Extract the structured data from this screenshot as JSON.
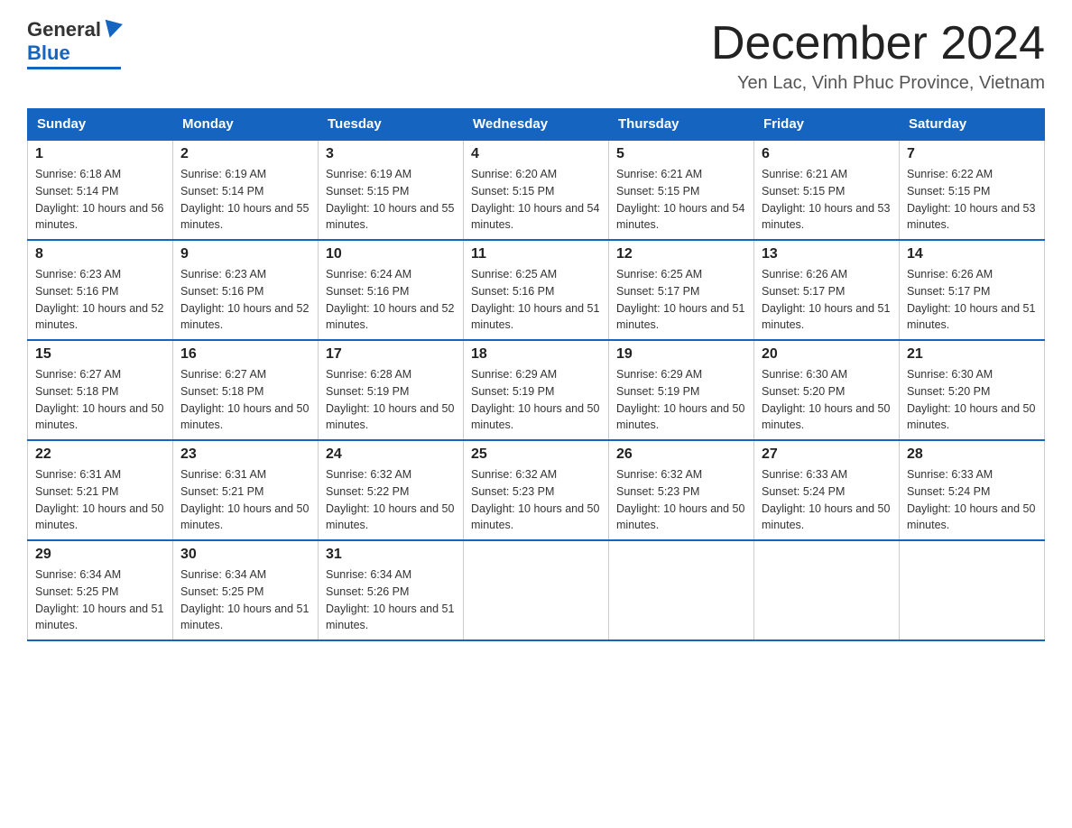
{
  "logo": {
    "general": "General",
    "blue": "Blue"
  },
  "title": "December 2024",
  "subtitle": "Yen Lac, Vinh Phuc Province, Vietnam",
  "days_of_week": [
    "Sunday",
    "Monday",
    "Tuesday",
    "Wednesday",
    "Thursday",
    "Friday",
    "Saturday"
  ],
  "weeks": [
    [
      {
        "num": "1",
        "sunrise": "6:18 AM",
        "sunset": "5:14 PM",
        "daylight": "10 hours and 56 minutes."
      },
      {
        "num": "2",
        "sunrise": "6:19 AM",
        "sunset": "5:14 PM",
        "daylight": "10 hours and 55 minutes."
      },
      {
        "num": "3",
        "sunrise": "6:19 AM",
        "sunset": "5:15 PM",
        "daylight": "10 hours and 55 minutes."
      },
      {
        "num": "4",
        "sunrise": "6:20 AM",
        "sunset": "5:15 PM",
        "daylight": "10 hours and 54 minutes."
      },
      {
        "num": "5",
        "sunrise": "6:21 AM",
        "sunset": "5:15 PM",
        "daylight": "10 hours and 54 minutes."
      },
      {
        "num": "6",
        "sunrise": "6:21 AM",
        "sunset": "5:15 PM",
        "daylight": "10 hours and 53 minutes."
      },
      {
        "num": "7",
        "sunrise": "6:22 AM",
        "sunset": "5:15 PM",
        "daylight": "10 hours and 53 minutes."
      }
    ],
    [
      {
        "num": "8",
        "sunrise": "6:23 AM",
        "sunset": "5:16 PM",
        "daylight": "10 hours and 52 minutes."
      },
      {
        "num": "9",
        "sunrise": "6:23 AM",
        "sunset": "5:16 PM",
        "daylight": "10 hours and 52 minutes."
      },
      {
        "num": "10",
        "sunrise": "6:24 AM",
        "sunset": "5:16 PM",
        "daylight": "10 hours and 52 minutes."
      },
      {
        "num": "11",
        "sunrise": "6:25 AM",
        "sunset": "5:16 PM",
        "daylight": "10 hours and 51 minutes."
      },
      {
        "num": "12",
        "sunrise": "6:25 AM",
        "sunset": "5:17 PM",
        "daylight": "10 hours and 51 minutes."
      },
      {
        "num": "13",
        "sunrise": "6:26 AM",
        "sunset": "5:17 PM",
        "daylight": "10 hours and 51 minutes."
      },
      {
        "num": "14",
        "sunrise": "6:26 AM",
        "sunset": "5:17 PM",
        "daylight": "10 hours and 51 minutes."
      }
    ],
    [
      {
        "num": "15",
        "sunrise": "6:27 AM",
        "sunset": "5:18 PM",
        "daylight": "10 hours and 50 minutes."
      },
      {
        "num": "16",
        "sunrise": "6:27 AM",
        "sunset": "5:18 PM",
        "daylight": "10 hours and 50 minutes."
      },
      {
        "num": "17",
        "sunrise": "6:28 AM",
        "sunset": "5:19 PM",
        "daylight": "10 hours and 50 minutes."
      },
      {
        "num": "18",
        "sunrise": "6:29 AM",
        "sunset": "5:19 PM",
        "daylight": "10 hours and 50 minutes."
      },
      {
        "num": "19",
        "sunrise": "6:29 AM",
        "sunset": "5:19 PM",
        "daylight": "10 hours and 50 minutes."
      },
      {
        "num": "20",
        "sunrise": "6:30 AM",
        "sunset": "5:20 PM",
        "daylight": "10 hours and 50 minutes."
      },
      {
        "num": "21",
        "sunrise": "6:30 AM",
        "sunset": "5:20 PM",
        "daylight": "10 hours and 50 minutes."
      }
    ],
    [
      {
        "num": "22",
        "sunrise": "6:31 AM",
        "sunset": "5:21 PM",
        "daylight": "10 hours and 50 minutes."
      },
      {
        "num": "23",
        "sunrise": "6:31 AM",
        "sunset": "5:21 PM",
        "daylight": "10 hours and 50 minutes."
      },
      {
        "num": "24",
        "sunrise": "6:32 AM",
        "sunset": "5:22 PM",
        "daylight": "10 hours and 50 minutes."
      },
      {
        "num": "25",
        "sunrise": "6:32 AM",
        "sunset": "5:23 PM",
        "daylight": "10 hours and 50 minutes."
      },
      {
        "num": "26",
        "sunrise": "6:32 AM",
        "sunset": "5:23 PM",
        "daylight": "10 hours and 50 minutes."
      },
      {
        "num": "27",
        "sunrise": "6:33 AM",
        "sunset": "5:24 PM",
        "daylight": "10 hours and 50 minutes."
      },
      {
        "num": "28",
        "sunrise": "6:33 AM",
        "sunset": "5:24 PM",
        "daylight": "10 hours and 50 minutes."
      }
    ],
    [
      {
        "num": "29",
        "sunrise": "6:34 AM",
        "sunset": "5:25 PM",
        "daylight": "10 hours and 51 minutes."
      },
      {
        "num": "30",
        "sunrise": "6:34 AM",
        "sunset": "5:25 PM",
        "daylight": "10 hours and 51 minutes."
      },
      {
        "num": "31",
        "sunrise": "6:34 AM",
        "sunset": "5:26 PM",
        "daylight": "10 hours and 51 minutes."
      },
      null,
      null,
      null,
      null
    ]
  ]
}
